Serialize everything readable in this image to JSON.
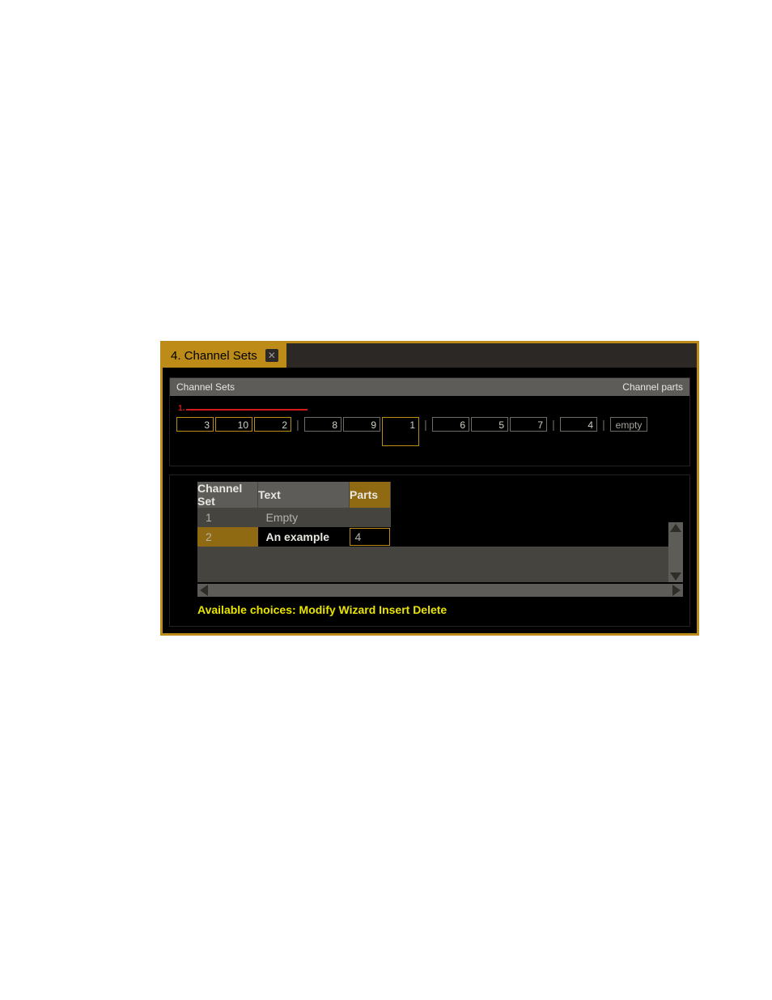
{
  "tab": {
    "title": "4. Channel Sets"
  },
  "header": {
    "left": "Channel Sets",
    "right": "Channel parts"
  },
  "annotation": {
    "label": "1."
  },
  "slots": {
    "group1": [
      "3",
      "10",
      "2"
    ],
    "group2": [
      "8",
      "9",
      "1"
    ],
    "group3": [
      "6",
      "5",
      "7"
    ],
    "group4": [
      "4"
    ],
    "empty": "empty"
  },
  "table": {
    "headers": {
      "chset": "Channel Set",
      "text": "Text",
      "parts": "Parts"
    },
    "rows": [
      {
        "id": "1",
        "text": "Empty",
        "parts": ""
      },
      {
        "id": "2",
        "text": "An example",
        "parts": "4"
      }
    ]
  },
  "choices": "Available choices: Modify Wizard Insert Delete"
}
